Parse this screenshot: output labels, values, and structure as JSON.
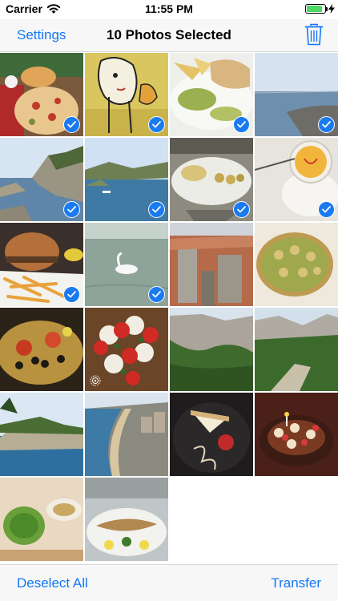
{
  "status_bar": {
    "carrier": "Carrier",
    "time": "11:55 PM",
    "battery_level": 0.85
  },
  "nav": {
    "left_label": "Settings",
    "title": "10 Photos Selected",
    "trash_icon": "trash-icon"
  },
  "toolbar": {
    "left_label": "Deselect All",
    "right_label": "Transfer"
  },
  "colors": {
    "accent": "#1477f6",
    "check_fill": "#1a7af0"
  },
  "photos": [
    {
      "subject": "pizza",
      "selected": true
    },
    {
      "subject": "street-art",
      "selected": true
    },
    {
      "subject": "wrap-and-guacamole",
      "selected": true
    },
    {
      "subject": "seaside",
      "selected": true
    },
    {
      "subject": "coastal-cliffs",
      "selected": true
    },
    {
      "subject": "bay-with-boat",
      "selected": true
    },
    {
      "subject": "appetizer-plate",
      "selected": true
    },
    {
      "subject": "drink-in-glass",
      "selected": true
    },
    {
      "subject": "burger-and-fries",
      "selected": true
    },
    {
      "subject": "swan-on-lake",
      "selected": true
    },
    {
      "subject": "old-town-rooftops",
      "selected": false
    },
    {
      "subject": "tart",
      "selected": false
    },
    {
      "subject": "seafood-platter",
      "selected": false
    },
    {
      "subject": "caprese-salad",
      "selected": false,
      "live": true
    },
    {
      "subject": "rocky-valley",
      "selected": false
    },
    {
      "subject": "mountain-trail",
      "selected": false
    },
    {
      "subject": "calanque-cliff",
      "selected": false
    },
    {
      "subject": "city-promenade",
      "selected": false
    },
    {
      "subject": "cheesecake-dessert",
      "selected": false
    },
    {
      "subject": "birthday-cake",
      "selected": false
    },
    {
      "subject": "table-of-dishes",
      "selected": false
    },
    {
      "subject": "grilled-fish-plate",
      "selected": false
    }
  ]
}
